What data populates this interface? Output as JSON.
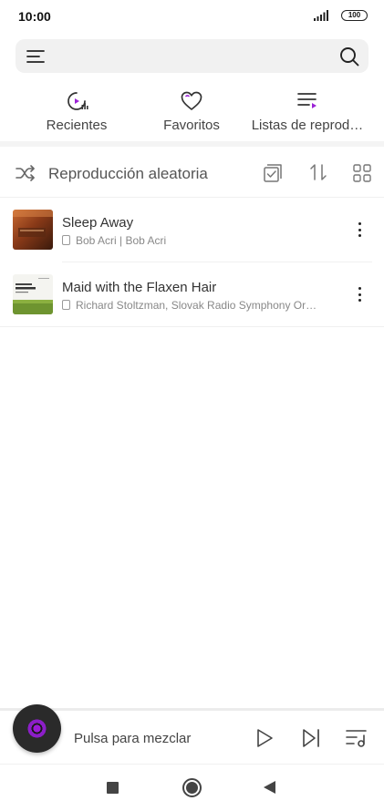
{
  "status_bar": {
    "time": "10:00",
    "battery": "100",
    "icons": [
      "signal-icon",
      "battery-icon"
    ]
  },
  "search_bar": {
    "icons": [
      "menu-icon",
      "search-icon"
    ]
  },
  "categories": [
    {
      "label": "Recientes",
      "icon": "recent-icon"
    },
    {
      "label": "Favoritos",
      "icon": "heart-icon"
    },
    {
      "label": "Listas de reprod…",
      "icon": "playlist-icon"
    }
  ],
  "toolbar": {
    "shuffle_label": "Reproducción aleatoria",
    "icons": [
      "shuffle-icon",
      "select-icon",
      "sort-icon",
      "grid-view-icon"
    ]
  },
  "tracks": [
    {
      "title": "Sleep Away",
      "subtitle": "Bob Acri | Bob Acri",
      "art": "sleep-away-cover"
    },
    {
      "title": "Maid with the Flaxen Hair",
      "subtitle": "Richard Stoltzman, Slovak Radio Symphony Or…",
      "art": "richard-stoltzman-cover"
    }
  ],
  "player": {
    "prompt": "Pulsa para mezclar",
    "icons": [
      "disc-icon",
      "play-icon",
      "next-icon",
      "queue-icon"
    ]
  },
  "nav": {
    "icons": [
      "recents-square-icon",
      "home-circle-icon",
      "back-triangle-icon"
    ]
  },
  "colors": {
    "accent": "#9b22d6",
    "text_primary": "#333333",
    "text_secondary": "#888888",
    "search_bg": "#f1f1f1"
  }
}
